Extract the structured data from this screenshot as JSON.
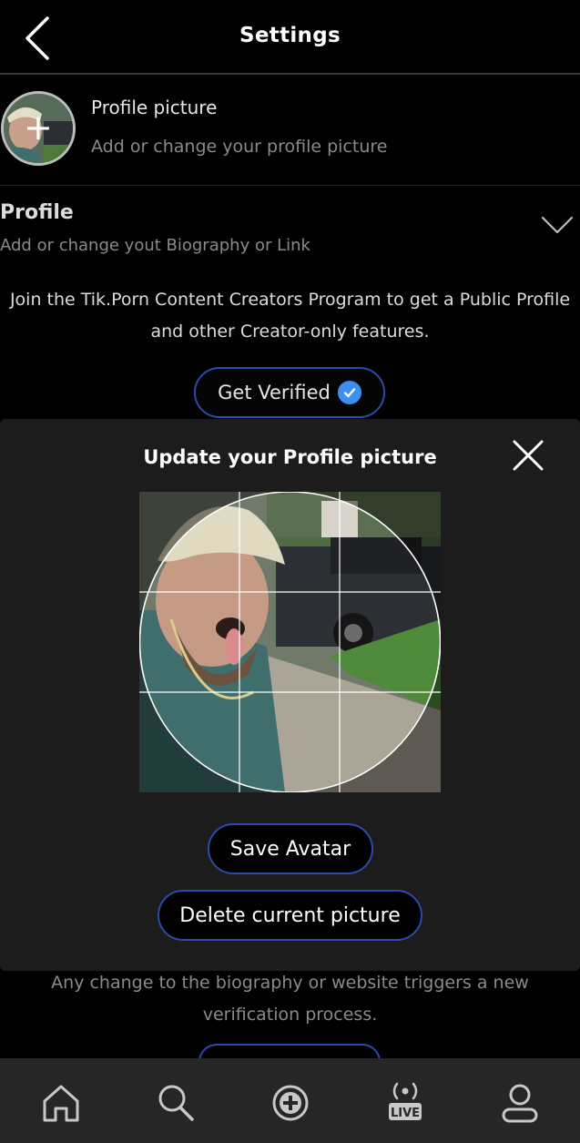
{
  "header": {
    "title": "Settings",
    "back_icon": "chevron-left-icon"
  },
  "profile_picture": {
    "title": "Profile picture",
    "subtitle": "Add or change your profile picture",
    "overlay_icon": "plus-icon"
  },
  "profile": {
    "title": "Profile",
    "subtitle": "Add or change yout Biography or Link",
    "toggle_icon": "chevron-down-icon"
  },
  "creator_info": {
    "text": "Join the Tik.Porn Content Creators Program to get a Public Profile and other Creator-only features."
  },
  "verify": {
    "label": "Get Verified",
    "icon": "verified-check-icon"
  },
  "verification_note": {
    "text": "Any change to the biography or website triggers a new verification process."
  },
  "modal": {
    "title": "Update your Profile picture",
    "close_icon": "close-icon",
    "save_label": "Save Avatar",
    "delete_label": "Delete current picture"
  },
  "bottom_nav": {
    "items": [
      {
        "icon": "home-icon"
      },
      {
        "icon": "search-icon"
      },
      {
        "icon": "add-icon"
      },
      {
        "icon": "live-icon",
        "badge": "LIVE"
      },
      {
        "icon": "profile-icon"
      }
    ]
  },
  "colors": {
    "background": "#000000",
    "modal_bg": "#1c1c1c",
    "nav_bg": "#262626",
    "accent_border": "#2d4aa8",
    "verified_blue": "#3d8ef0",
    "muted_text": "#8a8a8a"
  }
}
